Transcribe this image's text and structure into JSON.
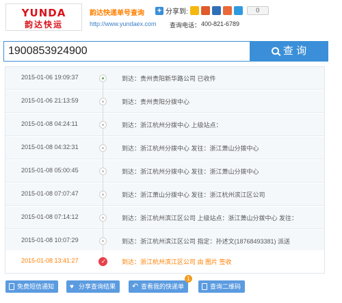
{
  "header": {
    "logo_top": "YUNDA",
    "logo_bottom": "韵达快运",
    "title": "韵达快递单号查询",
    "share_label": "分享到:",
    "share_count": "0",
    "url": "http://www.yundaex.com",
    "phone_label": "查询电话：",
    "phone": "400-821-6789",
    "colors": {
      "brand": "#d9121b",
      "accent": "#ff7f00",
      "blue": "#3b8fd8"
    }
  },
  "search": {
    "value": "1900853924900",
    "button_label": "查 询"
  },
  "tracking": {
    "rows": [
      {
        "time": "2015-01-06 19:09:37",
        "desc": "到达：贵州贵阳新华路公司 已收件"
      },
      {
        "time": "2015-01-06 21:13:59",
        "desc": "到达：贵州贵阳分拨中心"
      },
      {
        "time": "2015-01-08 04:24:11",
        "desc": "到达：浙江杭州分拨中心 上级站点："
      },
      {
        "time": "2015-01-08 04:32:31",
        "desc": "到达：浙江杭州分拨中心 发往：浙江萧山分拨中心"
      },
      {
        "time": "2015-01-08 05:00:45",
        "desc": "到达：浙江杭州分拨中心 发往：浙江萧山分拨中心"
      },
      {
        "time": "2015-01-08 07:07:47",
        "desc": "到达：浙江萧山分拨中心 发往：浙江杭州滨江区公司"
      },
      {
        "time": "2015-01-08 07:14:12",
        "desc": "到达：浙江杭州滨江区公司 上级站点：浙江萧山分拨中心 发往："
      },
      {
        "time": "2015-01-08 10:07:29",
        "desc": "到达：浙江杭州滨江区公司 指定：孙述文(18768493381) 派送"
      },
      {
        "time": "2015-01-08 13:41:27",
        "desc": "到达：浙江杭州滨江区公司 由 图片 签收"
      }
    ]
  },
  "footer": {
    "sms_label": "免费短信通知",
    "share_label": "分享查询结果",
    "my_label": "查看我的快递单",
    "my_badge": "1",
    "qr_label": "查询二维码"
  }
}
